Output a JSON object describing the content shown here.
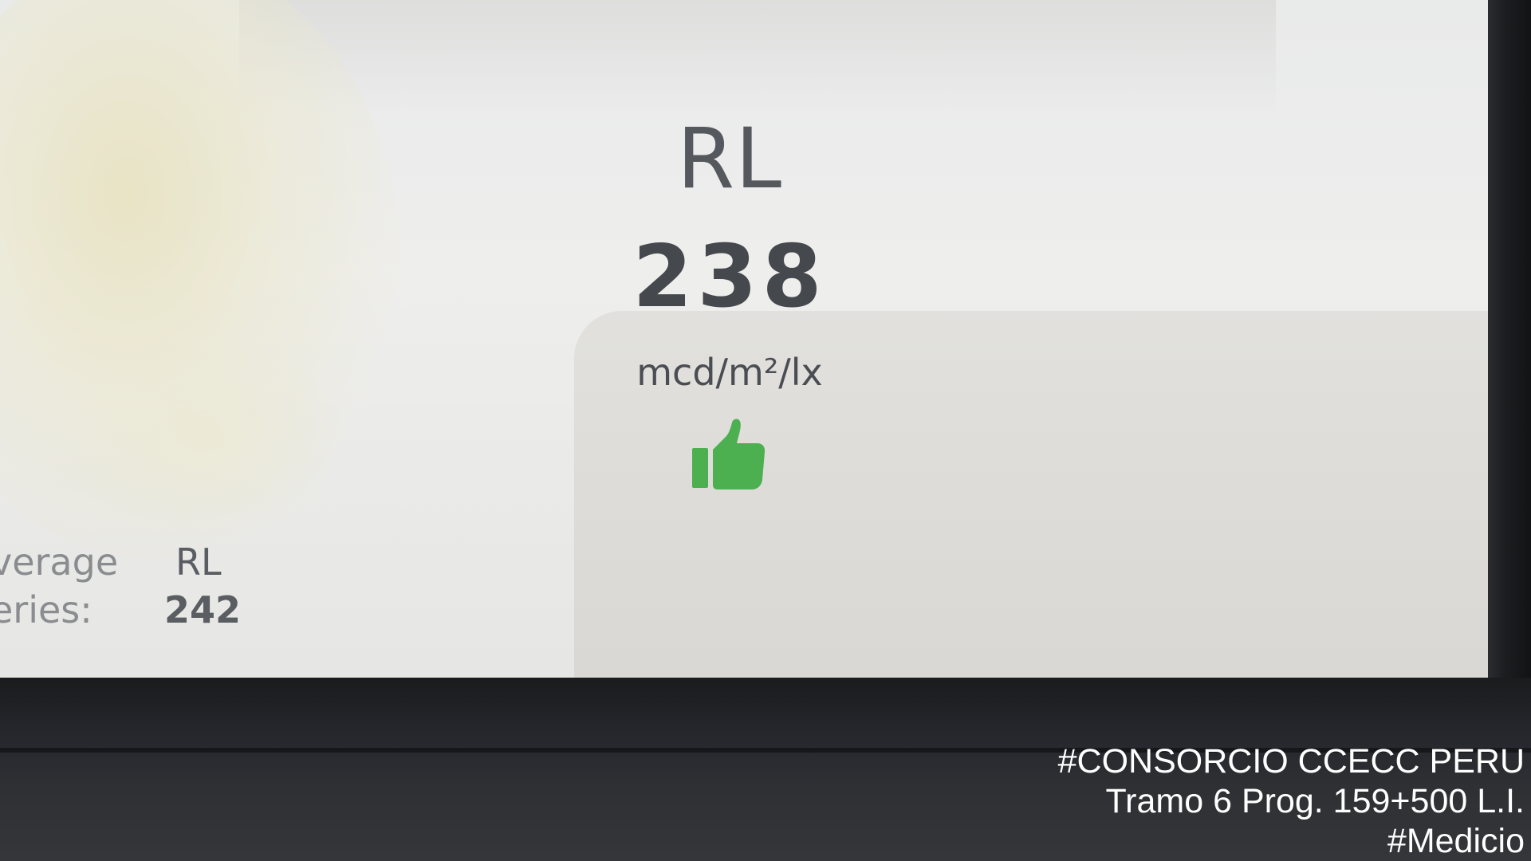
{
  "reading": {
    "label": "RL",
    "value": "238",
    "unit": "mcd/m²/lx",
    "status_icon": "thumbs-up-icon",
    "status_color": "#4caf50"
  },
  "summary": {
    "header_label": "verage",
    "header_value": "RL",
    "series_label": "eries:",
    "series_value": "242"
  },
  "watermark": {
    "line1": "#CONSORCIO CCECC PERU",
    "line2": "Tramo 6 Prog. 159+500 L.I.",
    "line3": "#Medicio"
  }
}
